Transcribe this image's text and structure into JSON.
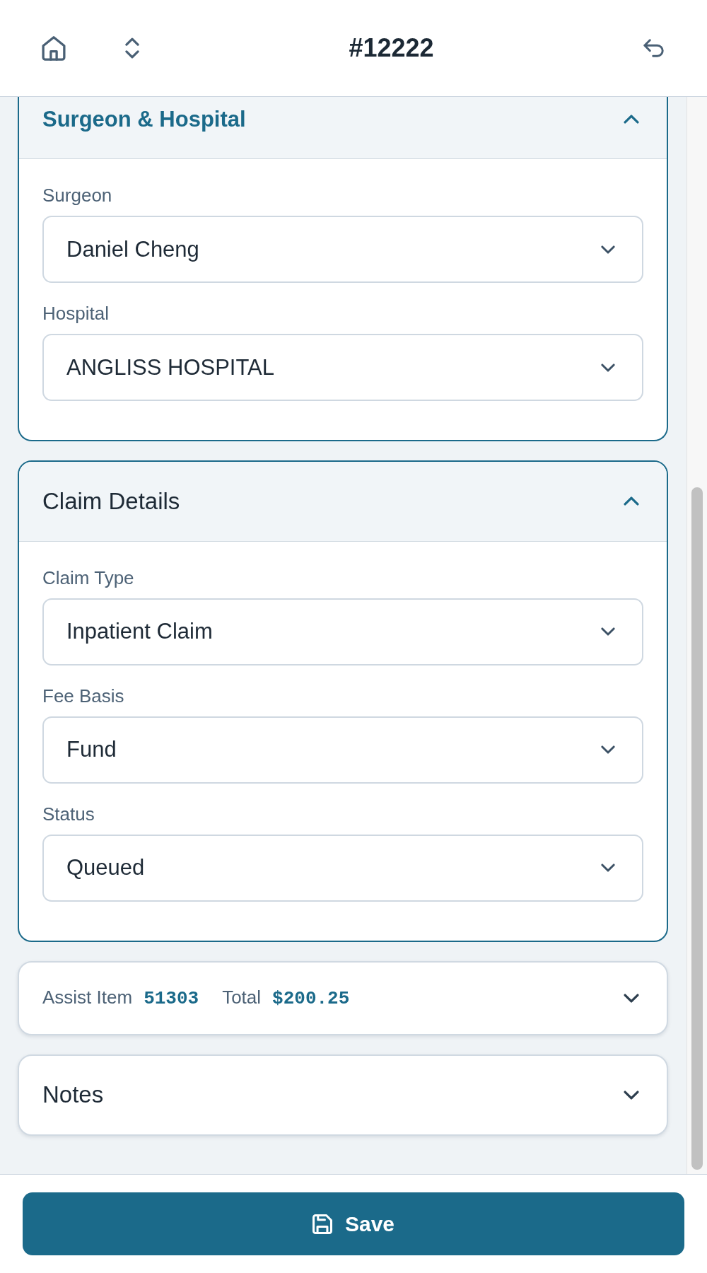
{
  "top_bar": {
    "title": "#12222"
  },
  "sections": [
    {
      "kind": "titled",
      "title": "Surgeon & Hospital",
      "active": true,
      "expanded": true,
      "fields": [
        {
          "label": "Surgeon",
          "value": "Daniel Cheng"
        },
        {
          "label": "Hospital",
          "value": "ANGLISS HOSPITAL"
        }
      ]
    },
    {
      "kind": "titled",
      "title": "Claim Details",
      "active": false,
      "expanded": true,
      "fields": [
        {
          "label": "Claim Type",
          "value": "Inpatient Claim"
        },
        {
          "label": "Fee Basis",
          "value": "Fund"
        },
        {
          "label": "Status",
          "value": "Queued"
        }
      ]
    },
    {
      "kind": "summary",
      "expanded": false,
      "items": [
        {
          "label": "Assist Item",
          "value": "51303"
        },
        {
          "label": "Total",
          "value": "$200.25"
        }
      ]
    },
    {
      "kind": "titled",
      "title": "Notes",
      "active": false,
      "expanded": false
    }
  ],
  "save_button": {
    "label": "Save"
  }
}
